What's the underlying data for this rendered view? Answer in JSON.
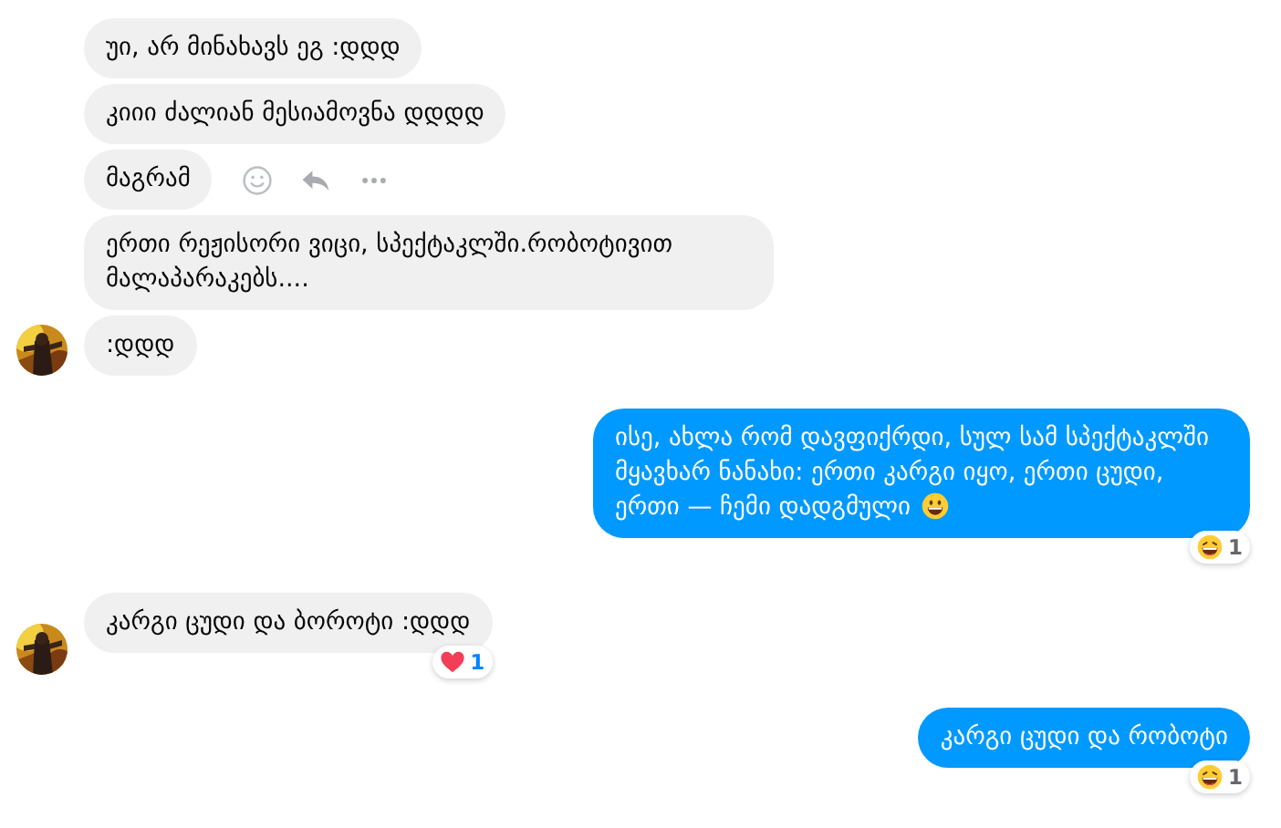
{
  "messages": [
    {
      "kind": "incoming",
      "text": "უი, არ მინახავს ეგ :დდდ",
      "avatar": false,
      "hover_actions": false
    },
    {
      "kind": "incoming",
      "text": "კიიი ძალიან მესიამოვნა დდდდ",
      "avatar": false,
      "hover_actions": false
    },
    {
      "kind": "incoming",
      "text": "მაგრამ",
      "avatar": false,
      "hover_actions": true
    },
    {
      "kind": "incoming",
      "text": "ერთი რეჟისორი ვიცი, სპექტაკლში.რობოტივით მალაპარაკებს....",
      "avatar": false,
      "hover_actions": false
    },
    {
      "kind": "incoming",
      "text": ":დდდ",
      "avatar": true,
      "hover_actions": false
    },
    {
      "kind": "outgoing",
      "text": "ისე, ახლა რომ დავფიქრდი, სულ სამ სპექტაკლში მყავხარ ნანახი: ერთი კარგი იყო, ერთი ცუდი, ერთი — ჩემი დადგმული",
      "emoji": {
        "kind": "grin"
      },
      "reaction": {
        "kind": "laugh",
        "count": "1",
        "mine": false
      }
    },
    {
      "kind": "incoming",
      "text": "კარგი ცუდი და ბოროტი :დდდ",
      "avatar": true,
      "hover_actions": false,
      "reaction": {
        "kind": "heart",
        "count": "1",
        "mine": true
      }
    },
    {
      "kind": "outgoing",
      "text": "კარგი ცუდი და რობოტი",
      "reaction": {
        "kind": "laugh",
        "count": "1",
        "mine": false
      }
    }
  ]
}
